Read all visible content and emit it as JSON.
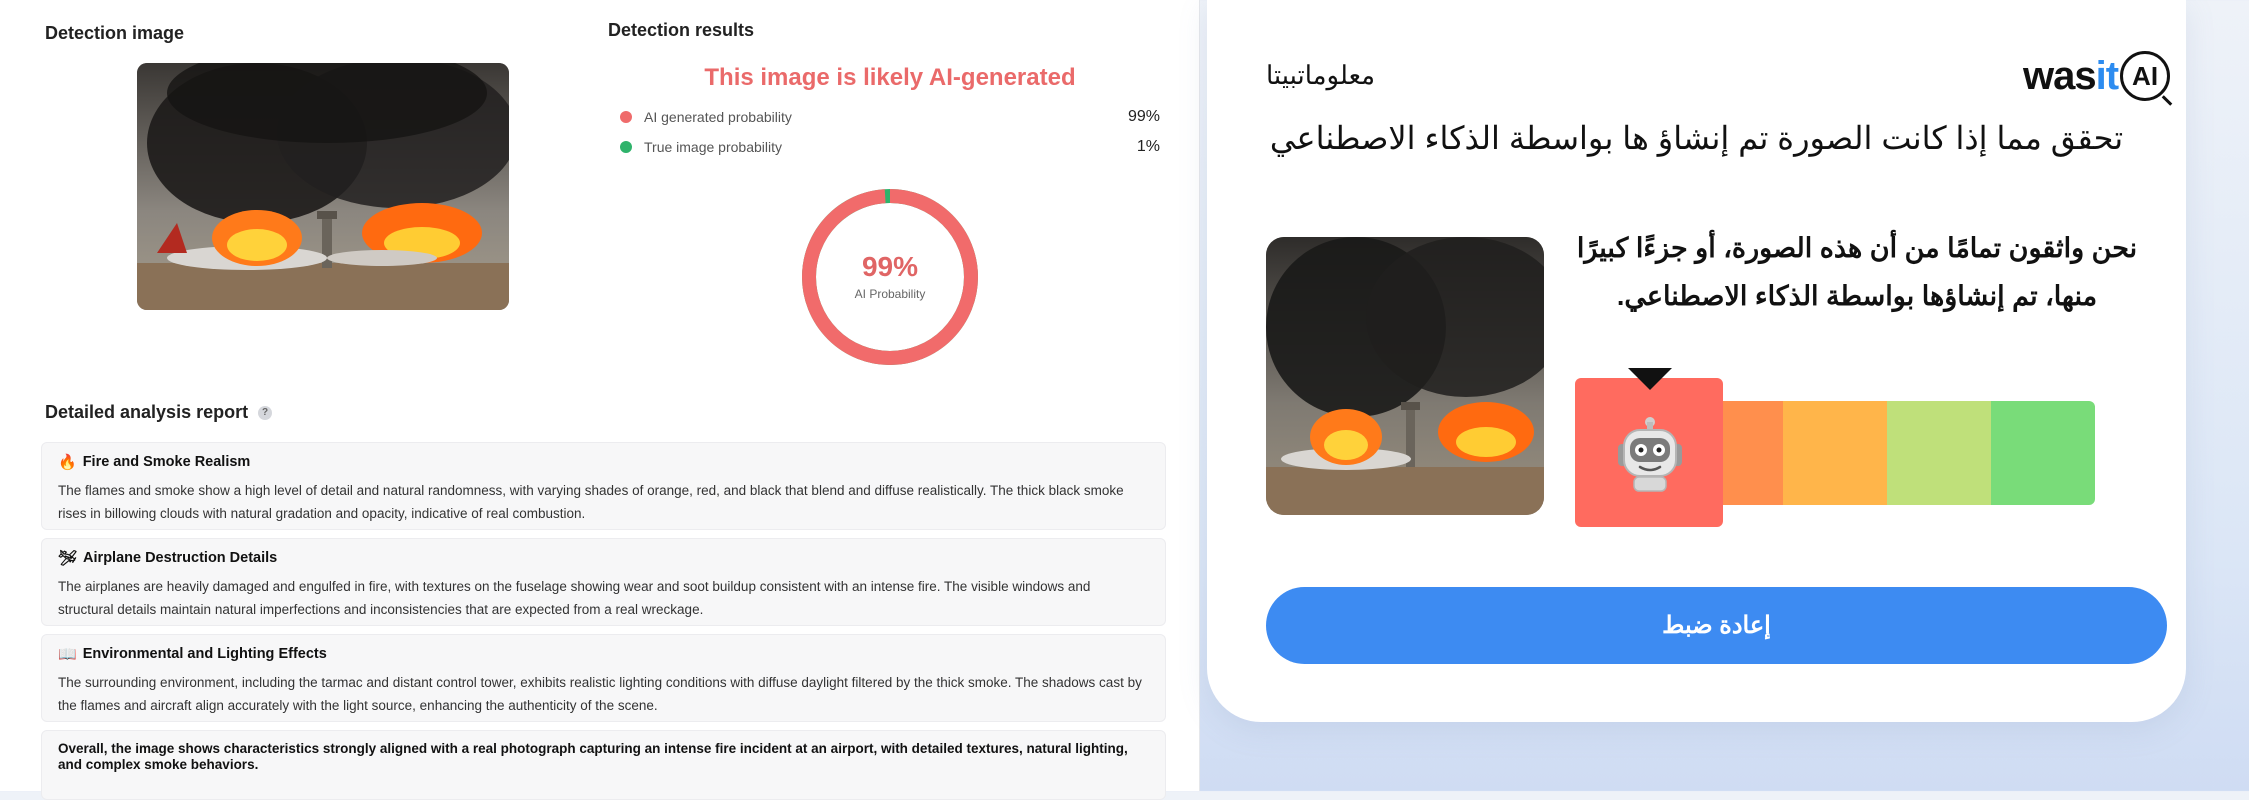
{
  "left": {
    "detection_image_title": "Detection image",
    "detection_results_title": "Detection results",
    "verdict": "This image is likely AI-generated",
    "probabilities": [
      {
        "label": "AI generated probability",
        "value": "99%",
        "color": "#ef6b6b"
      },
      {
        "label": "True image probability",
        "value": "1%",
        "color": "#2fb36b"
      }
    ],
    "donut": {
      "percent_text": "99%",
      "label": "AI Probability",
      "ai_fraction": 0.99
    },
    "report_title": "Detailed analysis report",
    "report_help_icon": "question-icon",
    "report_items": [
      {
        "icon": "fire-icon",
        "icon_glyph": "🔥",
        "title": "Fire and Smoke Realism",
        "body": "The flames and smoke show a high level of detail and natural randomness, with varying shades of orange, red, and black that blend and diffuse realistically. The thick black smoke rises in billowing clouds with natural gradation and opacity, indicative of real combustion."
      },
      {
        "icon": "airplane-icon",
        "icon_glyph": "🛩",
        "title": "Airplane Destruction Details",
        "body": "The airplanes are heavily damaged and engulfed in fire, with textures on the fuselage showing wear and soot buildup consistent with an intense fire. The visible windows and structural details maintain natural imperfections and inconsistencies that are expected from a real wreckage."
      },
      {
        "icon": "book-icon",
        "icon_glyph": "📖",
        "title": "Environmental and Lighting Effects",
        "body": "The surrounding environment, including the tarmac and distant control tower, exhibits realistic lighting conditions with diffuse daylight filtered by the thick smoke. The shadows cast by the flames and aircraft align accurately with the light source, enhancing the authenticity of the scene."
      }
    ],
    "summary": "Overall, the image shows characteristics strongly aligned with a real photograph capturing an intense fire incident at an airport, with detailed textures, natural lighting, and complex smoke behaviors."
  },
  "right": {
    "logo_text_w": "was",
    "logo_text_it": "it",
    "logo_text_ai": "AI",
    "beta_link": "معلوماتبيتا",
    "title": "تحقق مما إذا كانت الصورة تم إنشاؤ ها بواسطة الذكاء الاصطناعي",
    "message": "نحن واثقون تمامًا من أن هذه الصورة، أو جزءًا كبيرًا منها، تم إنشاؤها بواسطة الذكاء الاصطناعي.",
    "scale_colors": [
      "#ff6b5f",
      "#ff8f4d",
      "#ffb54a",
      "#bfe07a",
      "#79dc79"
    ],
    "scale_active_index": 0,
    "reset_button": "إعادة ضبط"
  }
}
